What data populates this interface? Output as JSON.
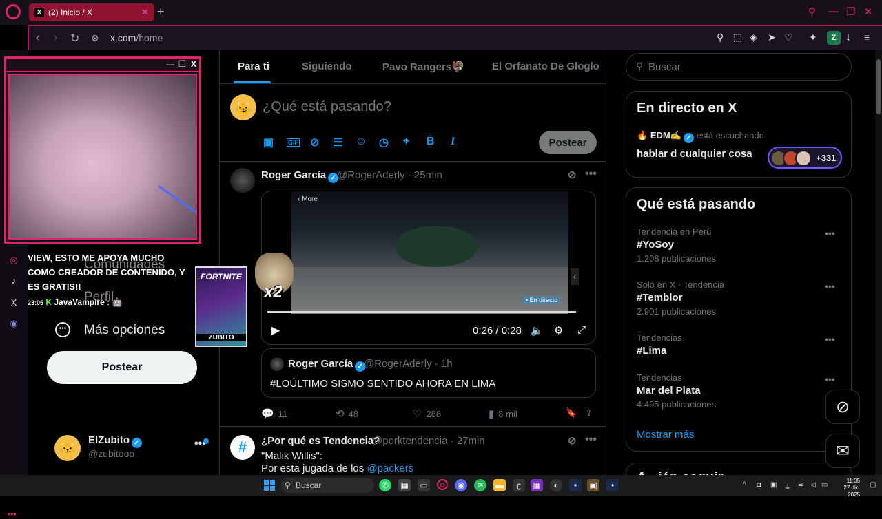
{
  "browser": {
    "tab_title": "(2) Inicio / X",
    "tab_close": "✕",
    "new_tab": "+",
    "url_host": "x.com",
    "url_path": "/home",
    "profile_badge": "Z"
  },
  "cam_overlay": {
    "minimize": "—",
    "restore": "❐",
    "close": "X"
  },
  "chat_overlay": {
    "message": "VIEW, ESTO ME APOYA MUCHO COMO CREADOR DE CONTENIDO, Y ES GRATIS!!",
    "time": "23:05",
    "user": "JavaVampire :",
    "emote": "🤖"
  },
  "promo_overlay": {
    "title": "FORTNITE",
    "footer": "ZUBITO",
    "multiplier": "x2"
  },
  "x_nav": {
    "communities": "Comunidades",
    "profile": "Perfil",
    "more_options": "Más opciones",
    "post_button": "Postear",
    "account_name": "ElZubito",
    "account_handle": "@zubitooo"
  },
  "timeline": {
    "tabs": [
      "Para ti",
      "Siguiendo",
      "Pavo Rangers🦃",
      "El Orfanato De Gloglo"
    ],
    "compose_placeholder": "¿Qué está pasando?",
    "compose_post": "Postear",
    "compose_tools": [
      "image-icon",
      "gif-icon",
      "grok-icon",
      "poll-icon",
      "emoji-icon",
      "schedule-icon",
      "location-icon",
      "bold-icon",
      "italic-icon"
    ],
    "tweet1": {
      "name": "Roger García",
      "handle": "@RogerAderly · 25min",
      "video_more": "‹ More",
      "video_live": "• En directo",
      "video_time": "0:26 / 0:28",
      "quote_name": "Roger García",
      "quote_handle": "@RogerAderly · 1h",
      "quote_text": "#LOÚLTIMO SISMO SENTIDO AHORA EN LIMA",
      "replies": "11",
      "reposts": "48",
      "likes": "288",
      "views": "8 mil"
    },
    "tweet2": {
      "name": "¿Por qué es Tendencia?",
      "handle": "@porktendencia · 27min",
      "line1": "\"Malik Willis\":",
      "line2": "Por esta jugada de los ",
      "link": "@packers"
    }
  },
  "sidebar": {
    "search_placeholder": "Buscar",
    "live_title": "En directo en X",
    "live_host": "EDM✍",
    "live_status": "está escuchando",
    "live_topic": "hablar d cualquier cosa",
    "live_count": "+331",
    "trends_title": "Qué está pasando",
    "trends": [
      {
        "context": "Tendencia en Perú",
        "name": "#YoSoy",
        "count": "1.208 publicaciones"
      },
      {
        "context": "Solo en X · Tendencia",
        "name": "#Temblor",
        "count": "2.901 publicaciones"
      },
      {
        "context": "Tendencias",
        "name": "#Lima",
        "count": ""
      },
      {
        "context": "Tendencias",
        "name": "Mar del Plata",
        "count": "4.495 publicaciones"
      }
    ],
    "show_more": "Mostrar más",
    "next_card_title": "A...ién seguir"
  },
  "taskbar": {
    "search": "Buscar",
    "time": "11:05",
    "date": "27 dic. 2025"
  },
  "colors": {
    "accent": "#1d9bf0",
    "opera_red": "#e0245e",
    "background": "#000000"
  }
}
